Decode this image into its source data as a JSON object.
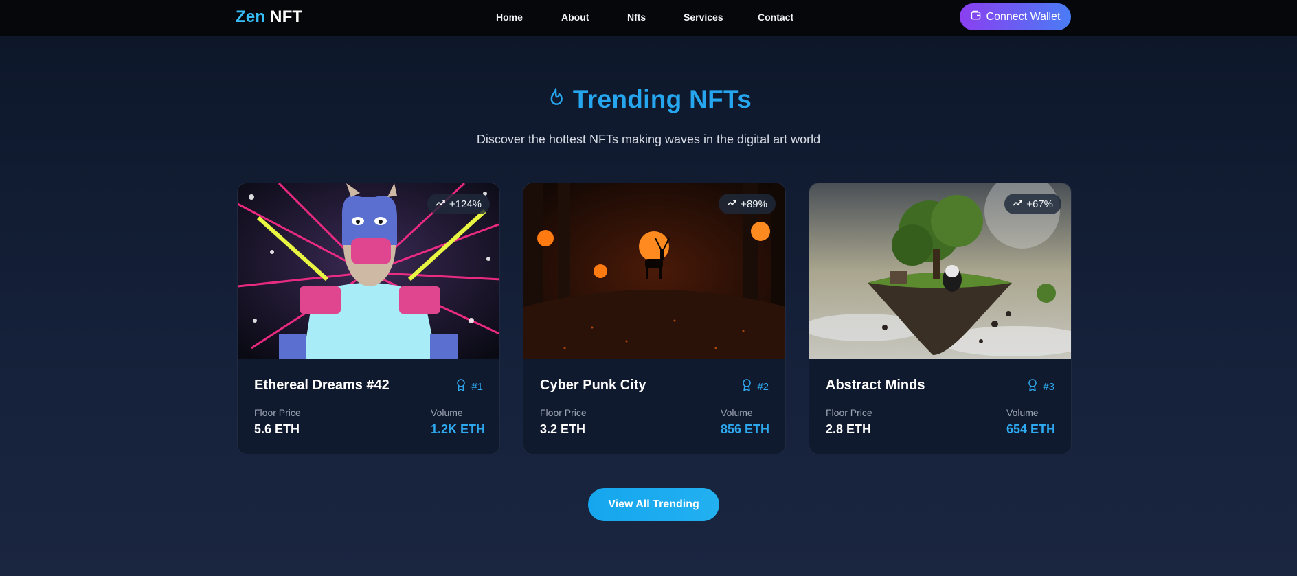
{
  "nav": {
    "logo_part1": "Zen",
    "logo_part2": "NFT",
    "links": [
      "Home",
      "About",
      "Nfts",
      "Services",
      "Contact"
    ],
    "wallet_label": "Connect Wallet"
  },
  "hero": {
    "title": "Trending NFTs",
    "subtitle": "Discover the hottest NFTs making waves in the digital art world",
    "title_icon": "flame-icon",
    "accent_color": "#25a6ee"
  },
  "cards": [
    {
      "name": "Ethereal Dreams #42",
      "rank": "#1",
      "change": "+124%",
      "floor_label": "Floor Price",
      "floor_value": "5.6 ETH",
      "volume_label": "Volume",
      "volume_value": "1.2K ETH"
    },
    {
      "name": "Cyber Punk City",
      "rank": "#2",
      "change": "+89%",
      "floor_label": "Floor Price",
      "floor_value": "3.2 ETH",
      "volume_label": "Volume",
      "volume_value": "856 ETH"
    },
    {
      "name": "Abstract Minds",
      "rank": "#3",
      "change": "+67%",
      "floor_label": "Floor Price",
      "floor_value": "2.8 ETH",
      "volume_label": "Volume",
      "volume_value": "654 ETH"
    }
  ],
  "cta_label": "View All Trending"
}
